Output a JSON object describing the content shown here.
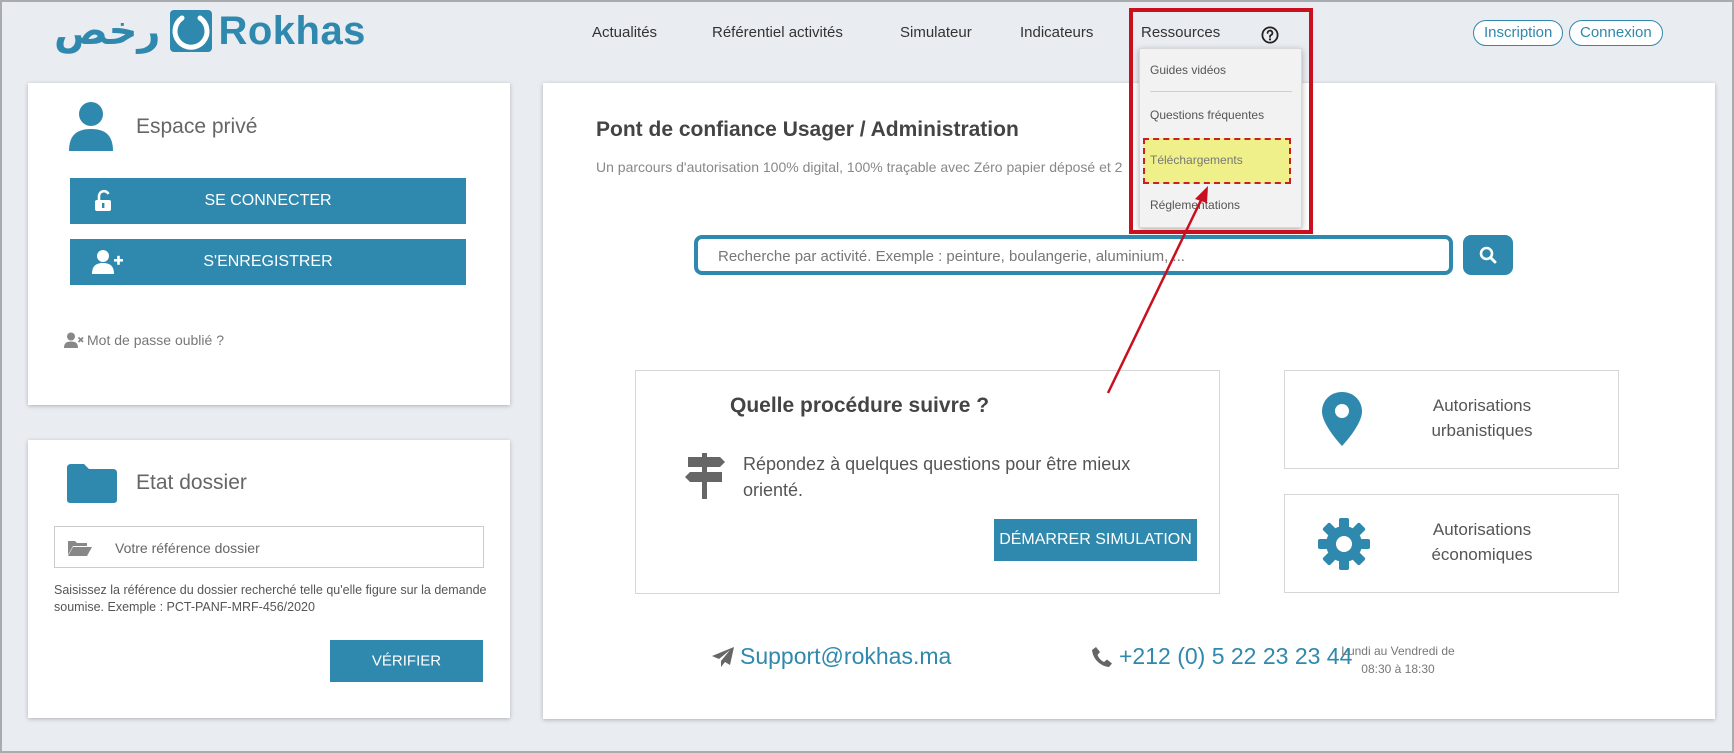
{
  "logo": {
    "arabic": "رخص",
    "latin": "Rokhas"
  },
  "nav": {
    "items": [
      "Actualités",
      "Référentiel activités",
      "Simulateur",
      "Indicateurs",
      "Ressources"
    ]
  },
  "auth": {
    "register": "Inscription",
    "login": "Connexion"
  },
  "dropdown": {
    "items": [
      "Guides vidéos",
      "Questions fréquentes",
      "Téléchargements",
      "Réglementations"
    ]
  },
  "private_space": {
    "title": "Espace privé",
    "connect_label": "SE CONNECTER",
    "register_label": "S'ENREGISTRER",
    "forgot_label": "Mot de passe oublié ?"
  },
  "dossier": {
    "title": "Etat dossier",
    "placeholder": "Votre référence dossier",
    "help": "Saisissez la référence du dossier recherché telle qu'elle figure sur la demande soumise. Exemple : PCT-PANF-MRF-456/2020",
    "verify_label": "VÉRIFIER"
  },
  "main": {
    "title": "Pont de confiance Usager / Administration",
    "subtitle": "Un parcours d'autorisation 100% digital, 100% traçable avec Zéro papier déposé et 2",
    "search_placeholder": "Recherche par activité. Exemple : peinture, boulangerie, aluminium, ...",
    "procedure": {
      "title": "Quelle procédure suivre ?",
      "text": "Répondez à quelques questions pour être mieux orienté.",
      "button": "DÉMARRER SIMULATION"
    },
    "urban": {
      "line1": "Autorisations",
      "line2": "urbanistiques"
    },
    "economic": {
      "line1": "Autorisations",
      "line2": "économiques"
    },
    "support_email": "Support@rokhas.ma",
    "phone": "+212 (0) 5 22 23 23 44",
    "hours_line1": "Lundi au Vendredi de",
    "hours_line2": "08:30 à 18:30"
  },
  "colors": {
    "brand": "#2f88ad",
    "annotation": "#c8101e",
    "highlight": "#f0f08a"
  }
}
